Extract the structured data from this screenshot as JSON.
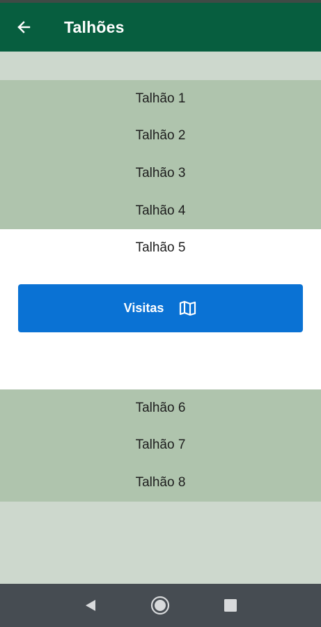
{
  "app": {
    "title": "Talhões",
    "theme_color": "#075e3f",
    "back_icon": "arrow-left-icon"
  },
  "list": {
    "items": [
      {
        "label": "Talhão 1",
        "selected": false
      },
      {
        "label": "Talhão 2",
        "selected": false
      },
      {
        "label": "Talhão 3",
        "selected": false
      },
      {
        "label": "Talhão 4",
        "selected": false
      },
      {
        "label": "Talhão 5",
        "selected": true
      },
      {
        "label": "Talhão 6",
        "selected": false
      },
      {
        "label": "Talhão 7",
        "selected": false
      },
      {
        "label": "Talhão 8",
        "selected": false
      }
    ],
    "action": {
      "label": "Visitas",
      "icon": "map-icon",
      "color": "#0a72d4"
    }
  },
  "system_nav": {
    "back": "triangle-back-icon",
    "home": "circle-home-icon",
    "recents": "square-recents-icon"
  }
}
